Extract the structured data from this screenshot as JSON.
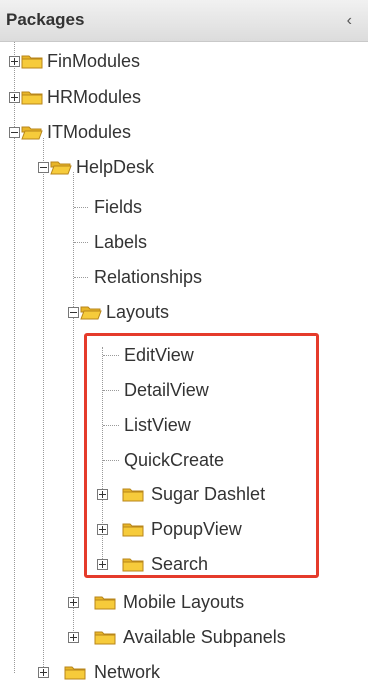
{
  "panel": {
    "title": "Packages",
    "collapse_glyph": "‹"
  },
  "tree": {
    "finmodules": "FinModules",
    "hrmodules": "HRModules",
    "itmodules": "ITModules",
    "helpdesk": "HelpDesk",
    "fields": "Fields",
    "labels": "Labels",
    "relationships": "Relationships",
    "layouts": "Layouts",
    "editview": "EditView",
    "detailview": "DetailView",
    "listview": "ListView",
    "quickcreate": "QuickCreate",
    "sugar_dashlet": "Sugar Dashlet",
    "popupview": "PopupView",
    "search": "Search",
    "mobile_layouts": "Mobile Layouts",
    "available_subpanels": "Available Subpanels",
    "network": "Network"
  },
  "colors": {
    "highlight": "#e53b2b",
    "folder": "#e8b528"
  }
}
